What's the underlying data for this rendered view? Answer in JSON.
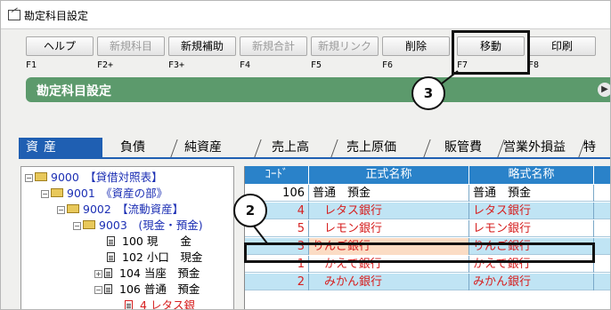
{
  "window": {
    "title": "勘定科目設定"
  },
  "toolbar": {
    "buttons": [
      {
        "label": "ヘルプ",
        "key": "F1",
        "enabled": true
      },
      {
        "label": "新規科目",
        "key": "F2+",
        "enabled": false
      },
      {
        "label": "新規補助",
        "key": "F3+",
        "enabled": true
      },
      {
        "label": "新規合計",
        "key": "F4",
        "enabled": false
      },
      {
        "label": "新規リンク",
        "key": "F5",
        "enabled": false
      },
      {
        "label": "削除",
        "key": "F6",
        "enabled": true
      },
      {
        "label": "移動",
        "key": "F7",
        "enabled": true
      },
      {
        "label": "印刷",
        "key": "F8",
        "enabled": true
      }
    ]
  },
  "header": {
    "title": "勘定科目設定"
  },
  "tabs": [
    {
      "label": "資産",
      "active": true
    },
    {
      "label": "負債",
      "active": false
    },
    {
      "label": "純資産",
      "active": false
    },
    {
      "label": "売上高",
      "active": false
    },
    {
      "label": "売上原価",
      "active": false
    },
    {
      "label": "販管費",
      "active": false
    },
    {
      "label": "営業外損益",
      "active": false
    },
    {
      "label": "特",
      "active": false
    }
  ],
  "tree": {
    "nodes": [
      {
        "code": "9000",
        "name": "【貸借対照表】"
      },
      {
        "code": "9001",
        "name": "《資産の部》"
      },
      {
        "code": "9002",
        "name": "【流動資産】"
      },
      {
        "code": "9003",
        "name": "(現金・預金)"
      },
      {
        "code": "100",
        "name": "現　　金"
      },
      {
        "code": "102",
        "name": "小口　現金"
      },
      {
        "code": "104",
        "name": "当座　預金"
      },
      {
        "code": "106",
        "name": "普通　預金"
      },
      {
        "code": "4",
        "name": "レタス銀"
      }
    ]
  },
  "grid": {
    "headers": [
      "ｺｰﾄﾞ",
      "正式名称",
      "略式名称"
    ],
    "rows": [
      {
        "code": "106",
        "name": "普通　預金",
        "short": "普通　預金",
        "style": "white",
        "color": "black"
      },
      {
        "code": "4",
        "name": "　レタス銀行",
        "short": "レタス銀行",
        "style": "blue",
        "color": "red"
      },
      {
        "code": "5",
        "name": "　レモン銀行",
        "short": "レモン銀行",
        "style": "white",
        "color": "red"
      },
      {
        "code": "3",
        "name": "りんご銀行",
        "short": "りんご銀行",
        "style": "blue",
        "color": "red",
        "selected": true
      },
      {
        "code": "1",
        "name": "　かえで銀行",
        "short": "かえで銀行",
        "style": "white",
        "color": "red"
      },
      {
        "code": "2",
        "name": "　みかん銀行",
        "short": "みかん銀行",
        "style": "blue",
        "color": "red"
      }
    ]
  },
  "callouts": [
    "2",
    "3"
  ]
}
